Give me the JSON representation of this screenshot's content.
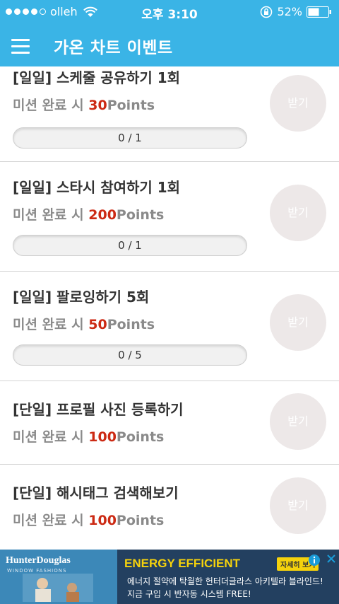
{
  "status_bar": {
    "carrier": "olleh",
    "time": "오후 3:10",
    "battery": "52%"
  },
  "header": {
    "title": "가온 차트 이벤트"
  },
  "missions": [
    {
      "title": "[일일] 스케줄 공유하기 1회",
      "reward_prefix": "미션 완료 시 ",
      "reward_points": "30",
      "reward_suffix": "Points",
      "progress": "0 / 1",
      "button": "받기"
    },
    {
      "title": "[일일] 스타시 참여하기 1회",
      "reward_prefix": "미션 완료 시 ",
      "reward_points": "200",
      "reward_suffix": "Points",
      "progress": "0 / 1",
      "button": "받기"
    },
    {
      "title": "[일일] 팔로잉하기 5회",
      "reward_prefix": "미션 완료 시 ",
      "reward_points": "50",
      "reward_suffix": "Points",
      "progress": "0 / 5",
      "button": "받기"
    },
    {
      "title": "[단일] 프로필 사진 등록하기",
      "reward_prefix": "미션 완료 시 ",
      "reward_points": "100",
      "reward_suffix": "Points",
      "button": "받기"
    },
    {
      "title": "[단일] 해시태그 검색해보기",
      "reward_prefix": "미션 완료 시 ",
      "reward_points": "100",
      "reward_suffix": "Points",
      "button": "받기"
    }
  ],
  "ad": {
    "brand": "HunterDouglas",
    "brand_sub": "WINDOW FASHIONS",
    "headline": "ENERGY EFFICIENT",
    "cta": "자세히 보기",
    "line1": "에너지 절약에 탁월한 헌터더글라스 아키텔라 블라인드!",
    "line2": "지금 구입 시 반자동 시스템 FREE!"
  },
  "colors": {
    "accent": "#3ab4e6",
    "points": "#cc2a14",
    "button_disabled": "#ede8e8"
  }
}
